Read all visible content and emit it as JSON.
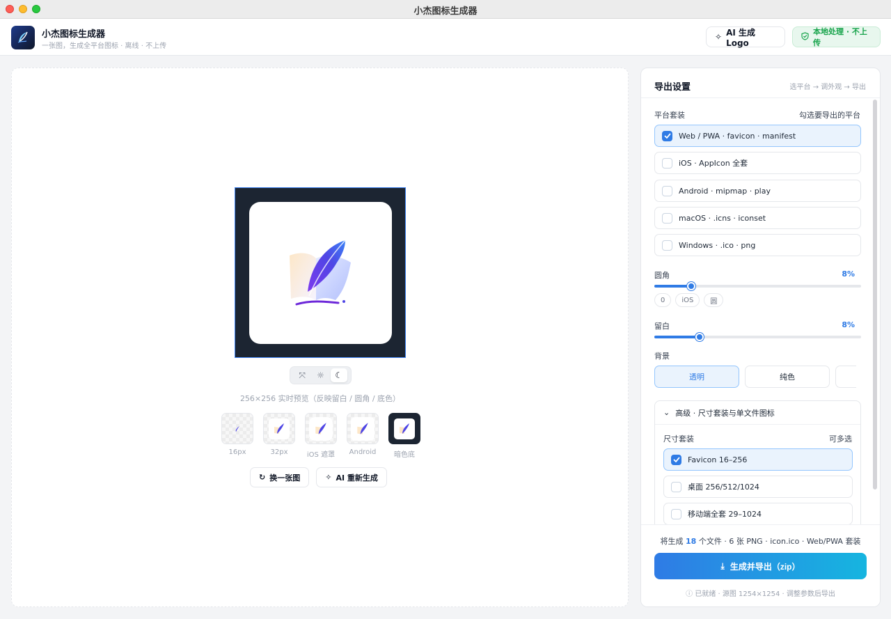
{
  "window": {
    "title": "小杰图标生成器"
  },
  "header": {
    "app_name": "小杰图标生成器",
    "app_subtitle": "一张图，生成全平台图标 · 离线 · 不上传",
    "ai_logo_label": "AI 生成 Logo",
    "local_badge": "本地处理 · 不上传"
  },
  "preview": {
    "caption": "256×256 实时预览（反映留白 / 圆角 / 底色）",
    "thumbnails": [
      {
        "label": "16px"
      },
      {
        "label": "32px"
      },
      {
        "label": "iOS 遮罩"
      },
      {
        "label": "Android"
      },
      {
        "label": "暗色底"
      }
    ],
    "replace_label": "换一张图",
    "regen_label": "AI 重新生成"
  },
  "panel": {
    "title": "导出设置",
    "steps": "选平台 → 调外观 → 导出",
    "platform_label": "平台套装",
    "platform_hint": "勾选要导出的平台",
    "platforms": [
      {
        "label": "Web / PWA · favicon · manifest",
        "checked": true
      },
      {
        "label": "iOS · AppIcon 全套",
        "checked": false
      },
      {
        "label": "Android · mipmap · play",
        "checked": false
      },
      {
        "label": "macOS · .icns · iconset",
        "checked": false
      },
      {
        "label": "Windows · .ico · png",
        "checked": false
      }
    ],
    "corner_label": "圆角",
    "corner_value": "8%",
    "corner_fraction": 0.18,
    "corner_chips": [
      "0",
      "iOS",
      "圆"
    ],
    "padding_label": "留白",
    "padding_value": "8%",
    "padding_fraction": 0.22,
    "bg_label": "背景",
    "bg_options": [
      "透明",
      "纯色"
    ],
    "advanced_title": "高级 · 尺寸套装与单文件图标",
    "size_label": "尺寸套装",
    "size_hint": "可多选",
    "sizes": [
      {
        "label": "Favicon 16–256",
        "checked": true
      },
      {
        "label": "桌面 256/512/1024",
        "checked": false
      },
      {
        "label": "移动端全套 29–1024",
        "checked": false
      }
    ],
    "summary_prefix": "将生成",
    "summary_count": "18",
    "summary_suffix": "个文件 · 6 张 PNG · icon.ico · Web/PWA 套装",
    "export_label": "生成并导出（zip）",
    "status": "已就绪 · 源图 1254×1254 · 调整参数后导出"
  },
  "colors": {
    "accent": "#2f7be5",
    "success": "#16a34a",
    "frame_dark": "#1c2532"
  }
}
